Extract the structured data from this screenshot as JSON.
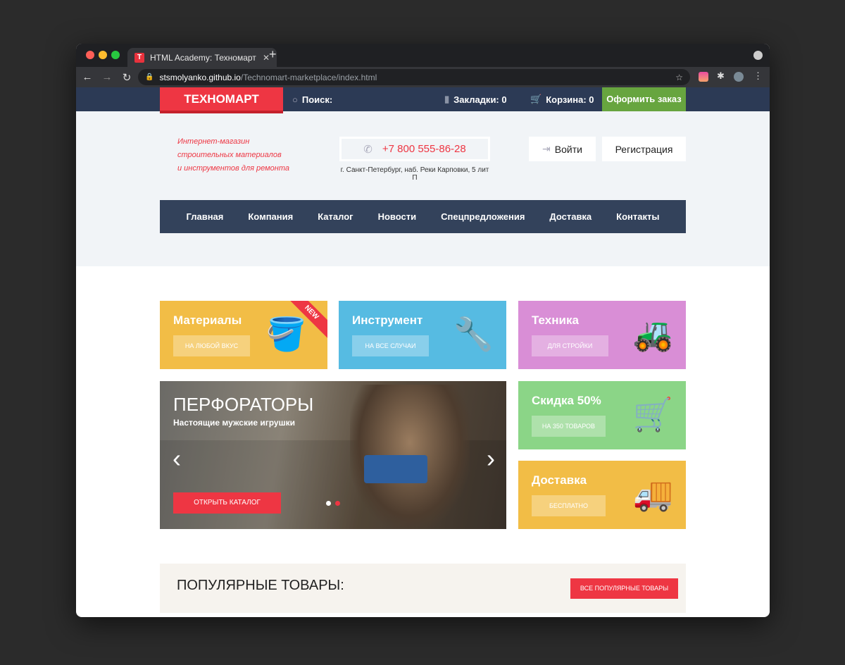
{
  "browser": {
    "tab_title": "HTML Academy: Техномарт",
    "url_host": "stsmolyanko.github.io",
    "url_path": "/Technomart-marketplace/index.html",
    "favicon": "T"
  },
  "topnav": {
    "logo": "ТЕХНОМАРТ",
    "search": "Поиск:",
    "bookmarks": "Закладки: 0",
    "cart": "Корзина: 0",
    "order": "Оформить заказ"
  },
  "header": {
    "slogan": [
      "Интернет-магазин",
      "строительных материалов",
      "и инструментов для ремонта"
    ],
    "phone": "+7 800 555-86-28",
    "address": "г. Санкт-Петербург, наб. Реки Карповки, 5 лит П",
    "login": "Войти",
    "register": "Регистрация"
  },
  "menu": [
    "Главная",
    "Компания",
    "Каталог",
    "Новости",
    "Спецпредложения",
    "Доставка",
    "Контакты"
  ],
  "cards": [
    {
      "title": "Материалы",
      "button": "на любой вкус",
      "badge": "NEW",
      "color": "#f2bd46"
    },
    {
      "title": "Инструмент",
      "button": "на все случаи",
      "color": "#56bbe2"
    },
    {
      "title": "Техника",
      "button": "для стройки",
      "color": "#d98ed6"
    },
    {
      "title": "Скидка 50%",
      "button": "на 350 товаров",
      "color": "#8bd587"
    },
    {
      "title": "Доставка",
      "button": "бесплатно",
      "color": "#f2bd46"
    }
  ],
  "slider": {
    "title": "ПЕРФОРАТОРЫ",
    "subtitle": "Настоящие мужские игрушки",
    "button": "ОТКРЫТЬ КАТАЛОГ"
  },
  "popular": {
    "title": "ПОПУЛЯРНЫЕ ТОВАРЫ:",
    "button": "ВСЕ ПОПУЛЯРНЫЕ ТОВАРЫ"
  }
}
